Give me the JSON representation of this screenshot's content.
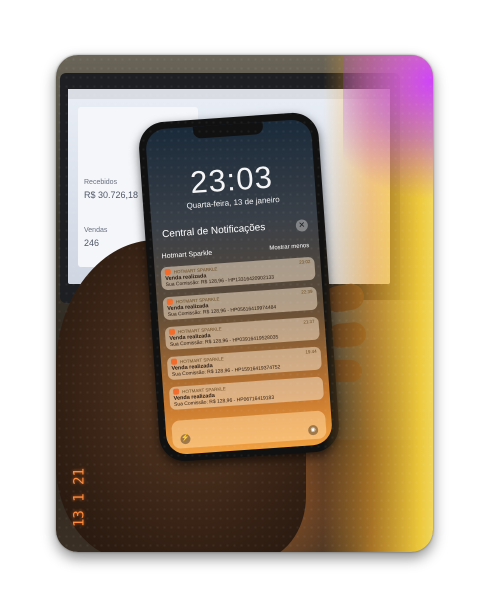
{
  "lock_screen": {
    "time": "23:03",
    "date": "Quarta-feira, 13 de janeiro",
    "notification_center_title": "Central de Notificações",
    "group_name": "Hotmart Sparkle",
    "group_action": "Mostrar menos",
    "notifications": [
      {
        "app": "HOTMART SPARKLE",
        "time": "23:02",
        "title": "Venda realizada",
        "body": "Sua Comissão: R$ 128,96 - HP13316420902133"
      },
      {
        "app": "HOTMART SPARKLE",
        "time": "22:39",
        "title": "Venda realizada",
        "body": "Sua Comissão: R$ 128,96 - HP05616419974484"
      },
      {
        "app": "HOTMART SPARKLE",
        "time": "21:37",
        "title": "Venda realizada",
        "body": "Sua Comissão: R$ 128,96 - HP03916419528035"
      },
      {
        "app": "HOTMART SPARKLE",
        "time": "19:44",
        "title": "Venda realizada",
        "body": "Sua Comissão: R$ 128,96 - HP15916419374752"
      },
      {
        "app": "HOTMART SPARKLE",
        "time": "",
        "title": "Venda realizada",
        "body": "Sua Comissão: R$ 128,96 - HP06716419183"
      }
    ]
  },
  "laptop_dashboard": {
    "label_1": "Recebidos",
    "value_1": "R$ 30.726,18",
    "label_2": "Vendas",
    "value_2": "246"
  },
  "date_stamp": "13 1 21",
  "colors": {
    "glow_orange": "#ffa030",
    "glow_purple": "#cd3cff",
    "stamp": "#ff8a3a"
  }
}
